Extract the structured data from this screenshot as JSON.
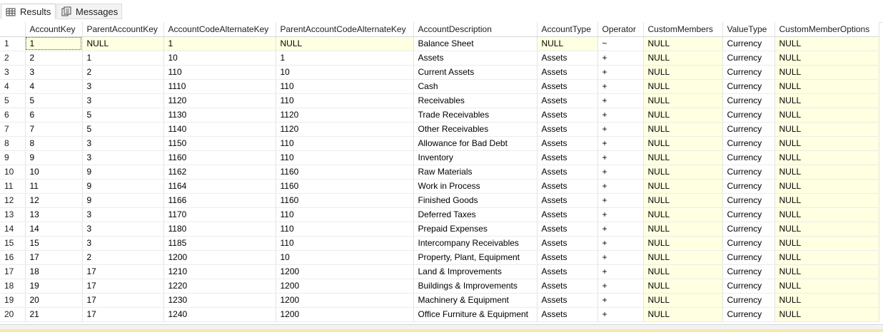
{
  "tabs": [
    {
      "label": "Results",
      "icon": "grid-icon",
      "active": true
    },
    {
      "label": "Messages",
      "icon": "messages-icon",
      "active": false
    }
  ],
  "columns": [
    "AccountKey",
    "ParentAccountKey",
    "AccountCodeAlternateKey",
    "ParentAccountCodeAlternateKey",
    "AccountDescription",
    "AccountType",
    "Operator",
    "CustomMembers",
    "ValueType",
    "CustomMemberOptions"
  ],
  "rows": [
    [
      "1",
      "1",
      "NULL",
      "1",
      "NULL",
      "Balance Sheet",
      "NULL",
      "~",
      "NULL",
      "Currency",
      "NULL"
    ],
    [
      "2",
      "2",
      "1",
      "10",
      "1",
      "Assets",
      "Assets",
      "+",
      "NULL",
      "Currency",
      "NULL"
    ],
    [
      "3",
      "3",
      "2",
      "110",
      "10",
      "Current Assets",
      "Assets",
      "+",
      "NULL",
      "Currency",
      "NULL"
    ],
    [
      "4",
      "4",
      "3",
      "1110",
      "110",
      "Cash",
      "Assets",
      "+",
      "NULL",
      "Currency",
      "NULL"
    ],
    [
      "5",
      "5",
      "3",
      "1120",
      "110",
      "Receivables",
      "Assets",
      "+",
      "NULL",
      "Currency",
      "NULL"
    ],
    [
      "6",
      "6",
      "5",
      "1130",
      "1120",
      "Trade Receivables",
      "Assets",
      "+",
      "NULL",
      "Currency",
      "NULL"
    ],
    [
      "7",
      "7",
      "5",
      "1140",
      "1120",
      "Other Receivables",
      "Assets",
      "+",
      "NULL",
      "Currency",
      "NULL"
    ],
    [
      "8",
      "8",
      "3",
      "1150",
      "110",
      "Allowance for Bad Debt",
      "Assets",
      "+",
      "NULL",
      "Currency",
      "NULL"
    ],
    [
      "9",
      "9",
      "3",
      "1160",
      "110",
      "Inventory",
      "Assets",
      "+",
      "NULL",
      "Currency",
      "NULL"
    ],
    [
      "10",
      "10",
      "9",
      "1162",
      "1160",
      "Raw Materials",
      "Assets",
      "+",
      "NULL",
      "Currency",
      "NULL"
    ],
    [
      "11",
      "11",
      "9",
      "1164",
      "1160",
      "Work in Process",
      "Assets",
      "+",
      "NULL",
      "Currency",
      "NULL"
    ],
    [
      "12",
      "12",
      "9",
      "1166",
      "1160",
      "Finished Goods",
      "Assets",
      "+",
      "NULL",
      "Currency",
      "NULL"
    ],
    [
      "13",
      "13",
      "3",
      "1170",
      "110",
      "Deferred Taxes",
      "Assets",
      "+",
      "NULL",
      "Currency",
      "NULL"
    ],
    [
      "14",
      "14",
      "3",
      "1180",
      "110",
      "Prepaid Expenses",
      "Assets",
      "+",
      "NULL",
      "Currency",
      "NULL"
    ],
    [
      "15",
      "15",
      "3",
      "1185",
      "110",
      "Intercompany Receivables",
      "Assets",
      "+",
      "NULL",
      "Currency",
      "NULL"
    ],
    [
      "16",
      "17",
      "2",
      "1200",
      "10",
      "Property, Plant, Equipment",
      "Assets",
      "+",
      "NULL",
      "Currency",
      "NULL"
    ],
    [
      "17",
      "18",
      "17",
      "1210",
      "1200",
      "Land & Improvements",
      "Assets",
      "+",
      "NULL",
      "Currency",
      "NULL"
    ],
    [
      "18",
      "19",
      "17",
      "1220",
      "1200",
      "Buildings & Improvements",
      "Assets",
      "+",
      "NULL",
      "Currency",
      "NULL"
    ],
    [
      "19",
      "20",
      "17",
      "1230",
      "1200",
      "Machinery & Equipment",
      "Assets",
      "+",
      "NULL",
      "Currency",
      "NULL"
    ],
    [
      "20",
      "21",
      "17",
      "1240",
      "1200",
      "Office Furniture & Equipment",
      "Assets",
      "+",
      "NULL",
      "Currency",
      "NULL"
    ]
  ],
  "colors": {
    "null_cell_bg": "#ffffe1",
    "grid_line": "#e4e4e4",
    "bottom_strip": "#f5e9a8"
  }
}
